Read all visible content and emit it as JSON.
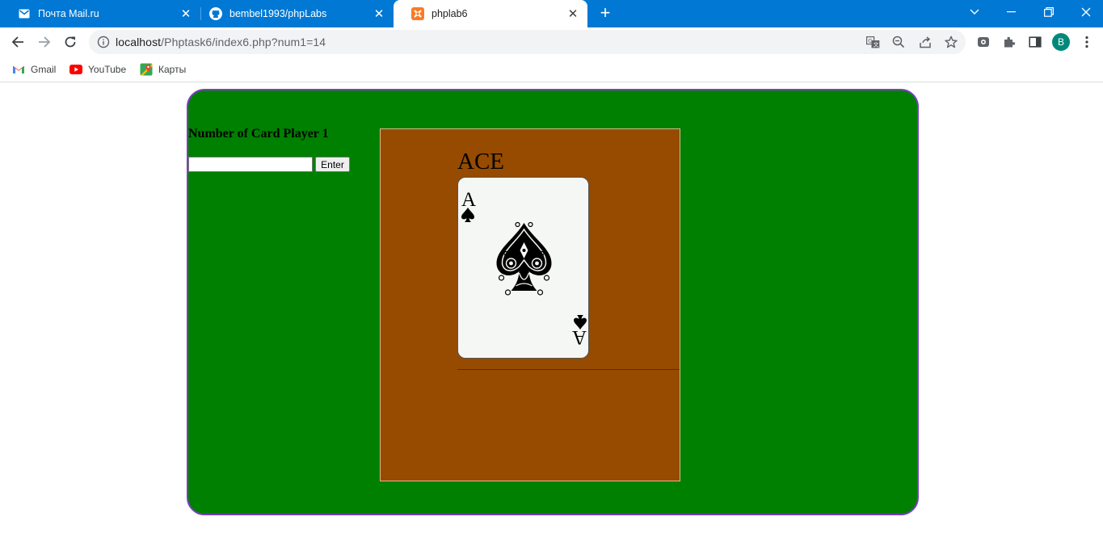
{
  "browser": {
    "tabs": [
      {
        "title": "Почта Mail.ru",
        "icon": "mail-icon",
        "active": false
      },
      {
        "title": "bembel1993/phpLabs",
        "icon": "github-icon",
        "active": false
      },
      {
        "title": "phplab6",
        "icon": "xampp-icon",
        "active": true
      }
    ],
    "close_glyph": "✕",
    "new_tab_glyph": "+",
    "address": {
      "host": "localhost",
      "path": "/Phptask6/index6.php?num1=14"
    },
    "profile_initial": "B",
    "bookmarks": [
      {
        "label": "Gmail",
        "icon": "gmail-icon"
      },
      {
        "label": "YouTube",
        "icon": "youtube-icon"
      },
      {
        "label": "Карты",
        "icon": "maps-icon"
      }
    ],
    "accent_color": "#0078d4"
  },
  "page": {
    "heading": "Number of Card Player 1",
    "input_value": "",
    "enter_label": "Enter",
    "card_name": "ACE",
    "card": {
      "rank": "A",
      "suit": "spades",
      "suit_glyph": "♠"
    },
    "colors": {
      "table": "#008000",
      "table_border": "#7b3fbf",
      "panel": "#964b00"
    }
  }
}
